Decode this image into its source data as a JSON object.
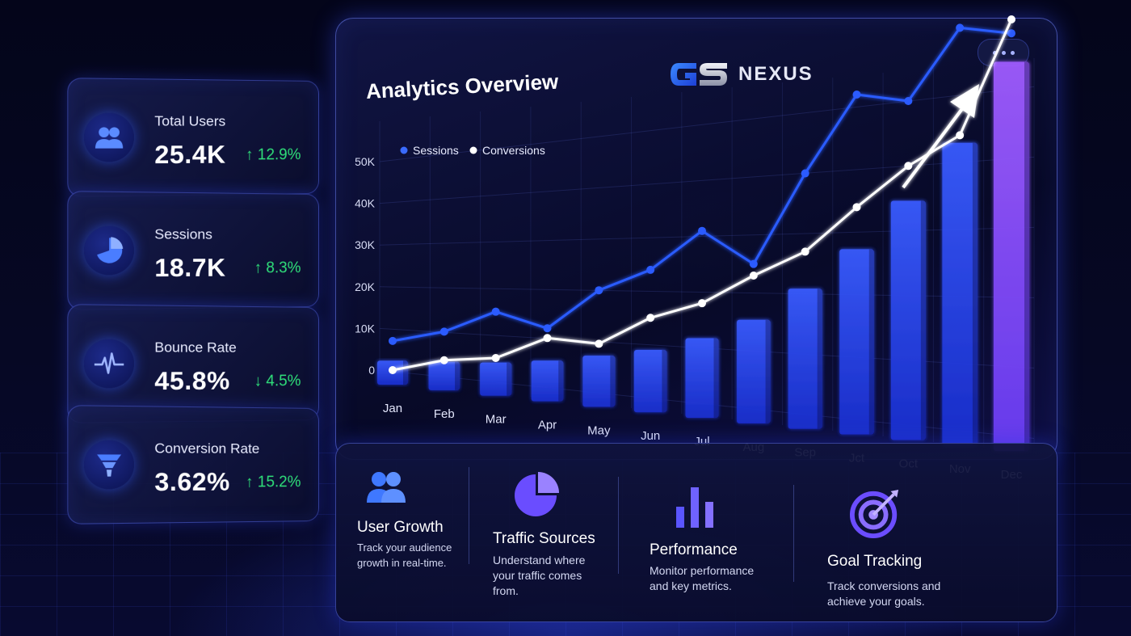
{
  "kpis": [
    {
      "label": "Total Users",
      "value": "25.4K",
      "delta": "↑ 12.9%",
      "icon": "users-icon"
    },
    {
      "label": "Sessions",
      "value": "18.7K",
      "delta": "↑ 8.3%",
      "icon": "pie-chart-icon"
    },
    {
      "label": "Bounce Rate",
      "value": "45.8%",
      "delta": "↓ 4.5%",
      "icon": "pulse-icon"
    },
    {
      "label": "Conversion Rate",
      "value": "3.62%",
      "delta": "↑ 15.2%",
      "icon": "funnel-icon"
    }
  ],
  "header": {
    "title": "Analytics Overview",
    "brand_name": "NEXUS",
    "brand_logo": "GS"
  },
  "colors": {
    "accent_blue": "#2b5bff",
    "accent_purple": "#8a4dff",
    "positive": "#2fe07a",
    "panel_border": "#5a6eff"
  },
  "chart_data": {
    "type": "line",
    "categories": [
      "Jan",
      "Feb",
      "Mar",
      "Apr",
      "May",
      "Jun",
      "Jul",
      "Aug",
      "Sep",
      "Jct",
      "Oct",
      "Nov",
      "Dec"
    ],
    "y_ticks": [
      "50K",
      "40K",
      "30K",
      "20K",
      "10K",
      "0"
    ],
    "ylim": [
      0,
      50000
    ],
    "grid": true,
    "legend_position": "top-left",
    "series": [
      {
        "name": "Sessions",
        "type": "line",
        "color": "#2b5bff",
        "values": [
          7000,
          10000,
          15000,
          12000,
          20000,
          24000,
          31000,
          25000,
          40000,
          52000,
          50000,
          60000,
          58000
        ]
      },
      {
        "name": "Conversions",
        "type": "line",
        "color": "#ffffff",
        "values": [
          0,
          3500,
          5000,
          10000,
          9500,
          15000,
          18000,
          23000,
          27000,
          34000,
          40000,
          44000,
          60000
        ]
      },
      {
        "type": "bar",
        "color": "#2b4dff",
        "values": [
          1500,
          2500,
          3500,
          5000,
          7000,
          9000,
          12000,
          16000,
          22000,
          29000,
          37000,
          46000,
          58000
        ]
      }
    ]
  },
  "features": [
    {
      "title": "User Growth",
      "desc": "Track your audience growth in real-time.",
      "icon": "users-icon"
    },
    {
      "title": "Traffic Sources",
      "desc": "Understand where your traffic comes from.",
      "icon": "pie-chart-icon"
    },
    {
      "title": "Performance",
      "desc": "Monitor performance and key metrics.",
      "icon": "bar-chart-icon"
    },
    {
      "title": "Goal Tracking",
      "desc": "Track conversions and achieve your goals.",
      "icon": "target-icon"
    }
  ]
}
